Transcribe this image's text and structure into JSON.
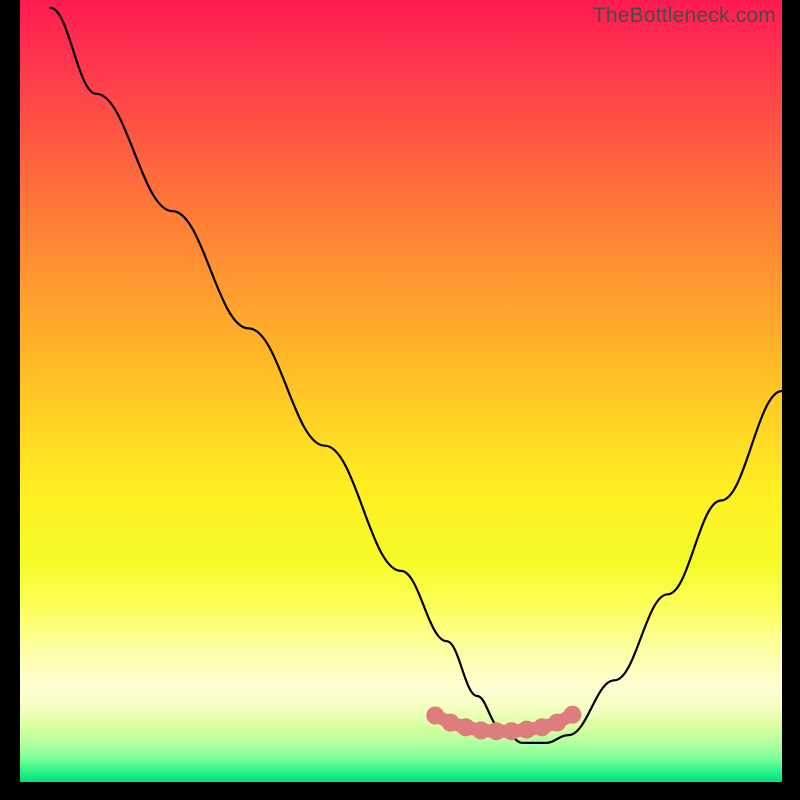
{
  "watermark": "TheBottleneck.com",
  "chart_data": {
    "type": "line",
    "title": "",
    "xlabel": "",
    "ylabel": "",
    "xlim": [
      0,
      100
    ],
    "ylim": [
      0,
      100
    ],
    "grid": false,
    "legend": false,
    "series": [
      {
        "name": "bottleneck-curve",
        "x": [
          4,
          10,
          20,
          30,
          40,
          50,
          56,
          60,
          63,
          66,
          69,
          72,
          78,
          85,
          92,
          100
        ],
        "y": [
          99,
          88,
          73,
          58,
          43,
          27,
          18,
          11,
          7,
          5,
          5,
          6,
          13,
          24,
          36,
          50
        ],
        "color": "#000000"
      },
      {
        "name": "marker-band",
        "x": [
          54.5,
          56.5,
          58.5,
          60.5,
          62.5,
          64.5,
          66.5,
          68.5,
          70.5,
          72.5
        ],
        "y": [
          8.5,
          7.6,
          7.0,
          6.6,
          6.5,
          6.5,
          6.7,
          7.0,
          7.6,
          8.6
        ],
        "color": "#dd7d7d"
      }
    ]
  },
  "colors": {
    "gradient_top": "#ff1a52",
    "gradient_mid": "#ffd324",
    "gradient_bottom": "#00e27a",
    "curve": "#000000",
    "marker": "#dd7d7d",
    "watermark": "#4a4a4a",
    "frame": "#000000"
  }
}
